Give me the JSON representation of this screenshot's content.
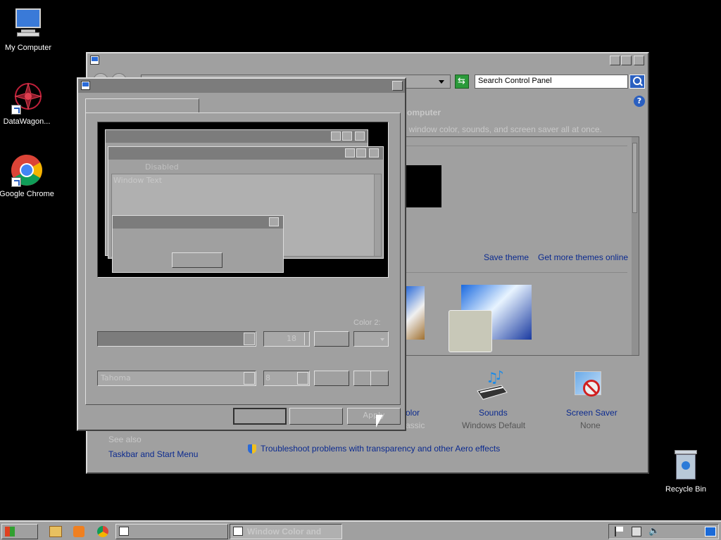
{
  "desktop": {
    "icons": [
      {
        "label": "My Computer"
      },
      {
        "label": "DataWagon..."
      },
      {
        "label": "Google Chrome"
      },
      {
        "label": "Recycle Bin"
      }
    ]
  },
  "control_panel": {
    "search_placeholder": "Search Control Panel",
    "heading_partial": "omputer",
    "description_partial": ", window color, sounds, and screen saver all at once.",
    "save_theme": "Save theme",
    "get_more_themes": "Get more themes online",
    "color_label_partial": "olor",
    "color_value_partial": "assic",
    "sounds_label": "Sounds",
    "sounds_value": "Windows Default",
    "screensaver_label": "Screen Saver",
    "screensaver_value": "None",
    "see_also": "See also",
    "taskbar_link": "Taskbar and Start Menu",
    "troubleshoot_link": "Troubleshoot problems with transparency and other Aero effects"
  },
  "dialog": {
    "preview_disabled": "Disabled",
    "preview_window_text": "Window Text",
    "color2_label": "Color 2:",
    "size_value": "18",
    "font_value": "Tahoma",
    "font_size_value": "8",
    "apply_label": "Apply"
  },
  "taskbar": {
    "active_task": "Window Color and Ap..."
  },
  "colors": {
    "link": "#0b2a8f",
    "titlebar": "#7c7c7c",
    "face": "#a0a0a0"
  }
}
